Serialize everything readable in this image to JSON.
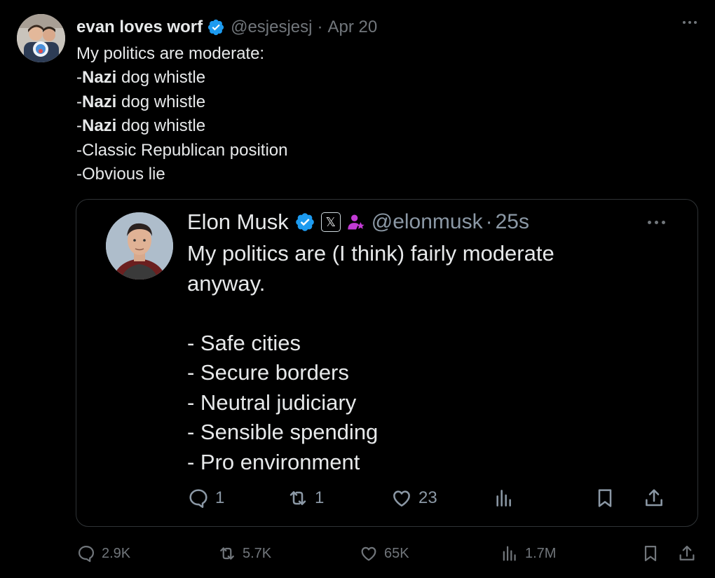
{
  "tweet": {
    "author": {
      "display_name": "evan loves worf",
      "handle": "@esjesjesj",
      "verified": true
    },
    "separator": "·",
    "date": "Apr 20",
    "text_lines": [
      {
        "bold": "",
        "rest": "My politics are moderate:"
      },
      {
        "prefix": "-",
        "bold": "Nazi",
        "rest": " dog whistle"
      },
      {
        "prefix": "-",
        "bold": "Nazi",
        "rest": " dog whistle"
      },
      {
        "prefix": "-",
        "bold": "Nazi",
        "rest": " dog whistle"
      },
      {
        "bold": "",
        "rest": "-Classic Republican position"
      },
      {
        "bold": "",
        "rest": "-Obvious lie"
      }
    ],
    "actions": {
      "replies": "2.9K",
      "reposts": "5.7K",
      "likes": "65K",
      "views": "1.7M"
    }
  },
  "quoted_tweet": {
    "author": {
      "display_name": "Elon Musk",
      "handle": "@elonmusk",
      "verified": true,
      "badge": "𝕏"
    },
    "separator": "·",
    "time": "25s",
    "text_lines": [
      "My politics are (I think) fairly moderate",
      "anyway.",
      "",
      "- Safe cities",
      "- Secure borders",
      "- Neutral judiciary",
      "- Sensible spending",
      "- Pro environment"
    ],
    "actions": {
      "replies": "1",
      "reposts": "1",
      "likes": "23"
    }
  },
  "colors": {
    "background": "#000000",
    "text": "#e7e9ea",
    "muted": "#71767b",
    "verified_blue": "#1d9bf0",
    "affiliate_pink": "#f91880"
  },
  "icons": [
    "more-icon",
    "verified-icon",
    "x-badge-icon",
    "affiliate-icon",
    "reply-icon",
    "repost-icon",
    "like-icon",
    "views-icon",
    "bookmark-icon",
    "share-icon"
  ]
}
